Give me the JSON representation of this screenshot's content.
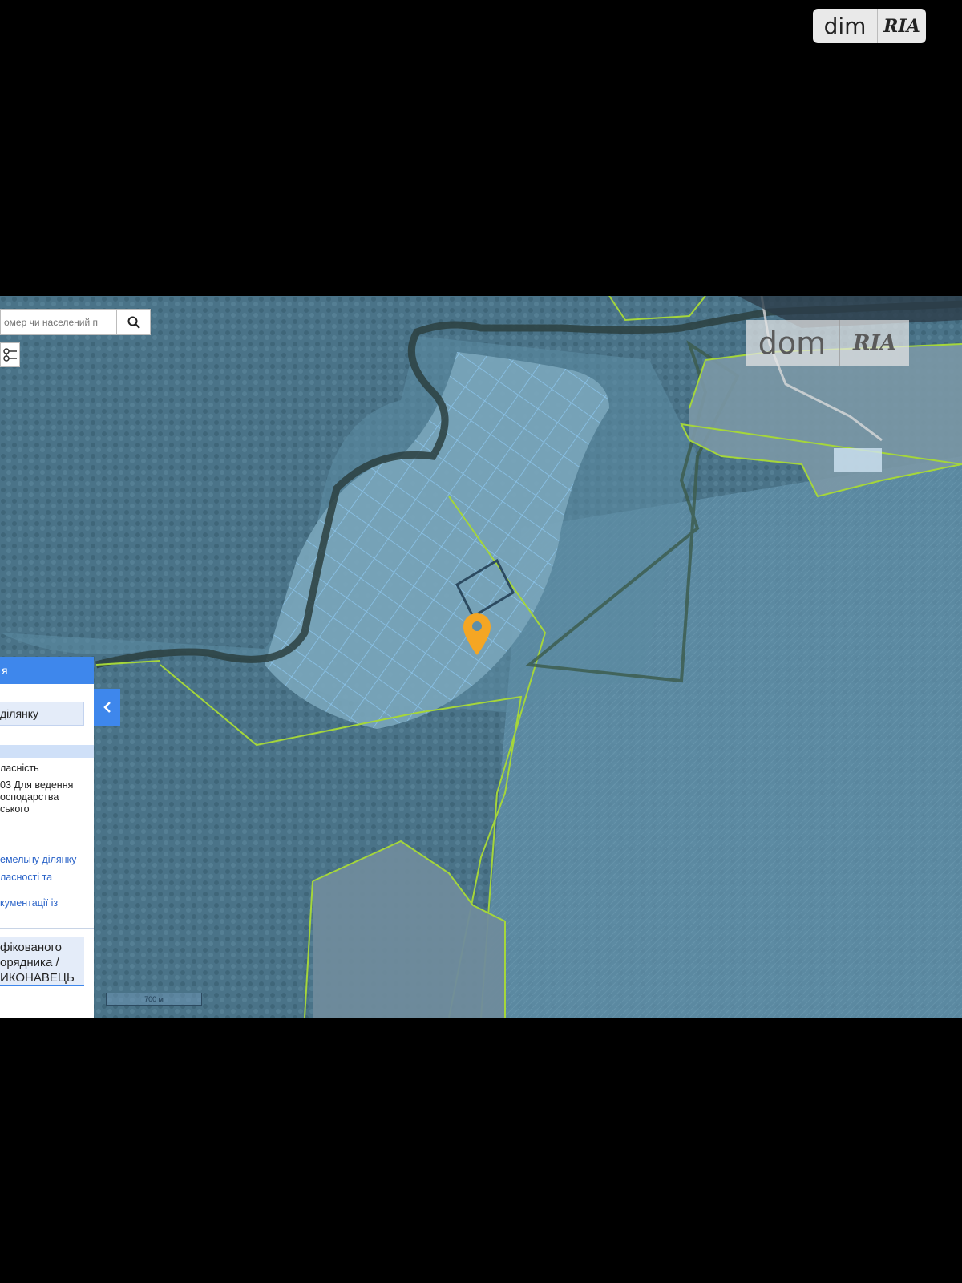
{
  "watermark": {
    "text": "dim",
    "logo": "RIA"
  },
  "map": {
    "search": {
      "placeholder": "омер чи населений п"
    },
    "watermark": {
      "text": "dom",
      "logo": "RIA"
    },
    "scale_label": "700 м",
    "icons": {
      "search": "search-icon",
      "layers": "layers-icon",
      "pin": "location-pin-icon",
      "collapse": "chevron-left-icon"
    },
    "colors": {
      "pin": "#f5a623",
      "boundary": "#a5d63a",
      "parcel": "#8ec8ff",
      "panel_accent": "#3e87ec"
    }
  },
  "side_panel": {
    "header": "я",
    "field_value": "ділянку",
    "ownership": "ласність",
    "purpose_lines": [
      "03 Для ведення",
      "осподарства",
      "ського"
    ],
    "link_lines": [
      "емельну ділянку",
      "ласності та"
    ],
    "doc_link": "кументації із",
    "box_lines": [
      "фікованого",
      "орядника /",
      "ИКОНАВЕЦЬ"
    ]
  }
}
